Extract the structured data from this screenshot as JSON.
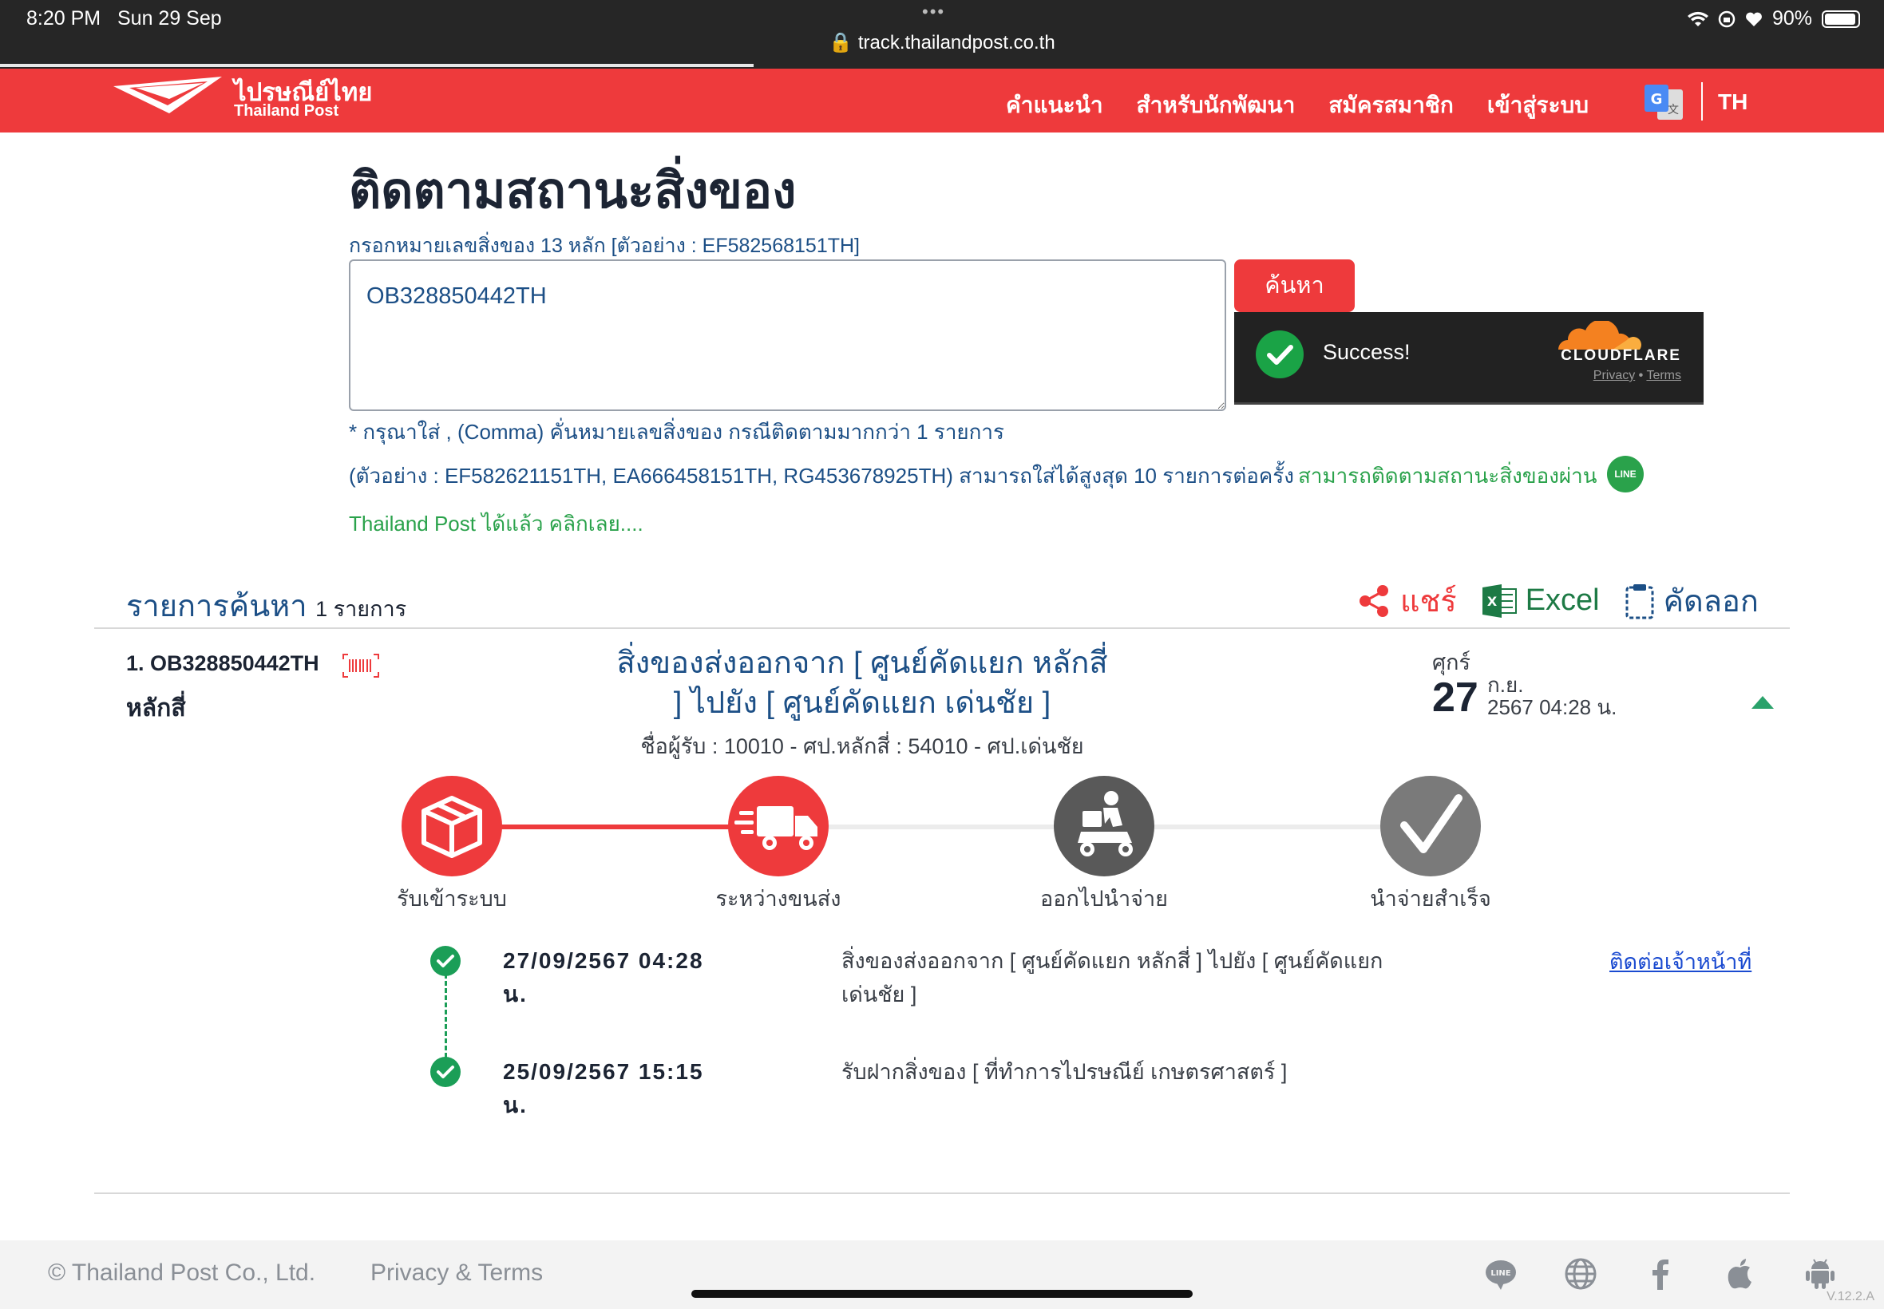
{
  "status_bar": {
    "time": "8:20 PM",
    "date": "Sun 29 Sep",
    "url": "track.thailandpost.co.th",
    "battery": "90%"
  },
  "header": {
    "brand_th": "ไปรษณีย์ไทย",
    "brand_en": "Thailand Post",
    "nav": [
      "คำแนะนำ",
      "สำหรับนักพัฒนา",
      "สมัครสมาชิก",
      "เข้าสู่ระบบ"
    ],
    "language": "TH",
    "accent_color": "#ee3a3c"
  },
  "search": {
    "title": "ติดตามสถานะสิ่งของ",
    "hint": "กรอกหมายเลขสิ่งของ 13 หลัก [ตัวอย่าง : EF582568151TH]",
    "input_value": "OB328850442TH",
    "button_label": "ค้นหา",
    "note1": "* กรุณาใส่ , (Comma) คั่นหมายเลขสิ่งของ กรณีติดตามมากกว่า 1 รายการ",
    "note2": "(ตัวอย่าง : EF582621151TH, EA666458151TH, RG453678925TH) สามารถใส่ได้สูงสุด 10 รายการต่อครั้ง",
    "line_note": "สามารถติดตามสถานะสิ่งของผ่าน",
    "line_badge": "LINE",
    "line_note2": "Thailand Post ได้แล้ว คลิกเลย....",
    "captcha": {
      "status": "Success!",
      "provider": "CLOUDFLARE",
      "privacy": "Privacy",
      "separator": "•",
      "terms": "Terms"
    }
  },
  "results": {
    "title": "รายการค้นหา",
    "count": "1 รายการ",
    "actions": {
      "share": "แชร์",
      "excel": "Excel",
      "copy": "คัดลอก"
    },
    "item": {
      "number": "1. OB328850442TH",
      "origin": "หลักสี่",
      "status": "สิ่งของส่งออกจาก [ ศูนย์คัดแยก หลักสี่ ] ไปยัง [ ศูนย์คัดแยก เด่นชัย ]",
      "receiver": "ชื่อผู้รับ : 10010 - ศป.หลักสี่ : 54010 - ศป.เด่นชัย",
      "day_of_week": "ศุกร์",
      "day": "27",
      "month": "ก.ย.",
      "year_time": "2567 04:28 น.",
      "steps": [
        {
          "label": "รับเข้าระบบ",
          "icon": "package-icon",
          "state": "done"
        },
        {
          "label": "ระหว่างขนส่ง",
          "icon": "truck-icon",
          "state": "current"
        },
        {
          "label": "ออกไปนำจ่าย",
          "icon": "delivery-scooter-icon",
          "state": "pending"
        },
        {
          "label": "นำจ่ายสำเร็จ",
          "icon": "checkmark-icon",
          "state": "pending"
        }
      ],
      "progress": 0.333,
      "timeline": [
        {
          "date": "27/09/2567 04:28",
          "date_suffix": "น.",
          "description": "สิ่งของส่งออกจาก [ ศูนย์คัดแยก หลักสี่ ] ไปยัง [ ศูนย์คัดแยก เด่นชัย ]"
        },
        {
          "date": "25/09/2567 15:15",
          "date_suffix": "น.",
          "description": "รับฝากสิ่งของ [ ที่ทำการไปรษณีย์ เกษตรศาสตร์ ]"
        }
      ],
      "contact_link": "ติดต่อเจ้าหน้าที่"
    }
  },
  "footer": {
    "copyright": "© Thailand Post Co., Ltd.",
    "privacy": "Privacy & Terms",
    "icons": [
      "line-icon",
      "globe-icon",
      "facebook-icon",
      "apple-icon",
      "android-icon"
    ],
    "version": "V.12.2.A"
  }
}
